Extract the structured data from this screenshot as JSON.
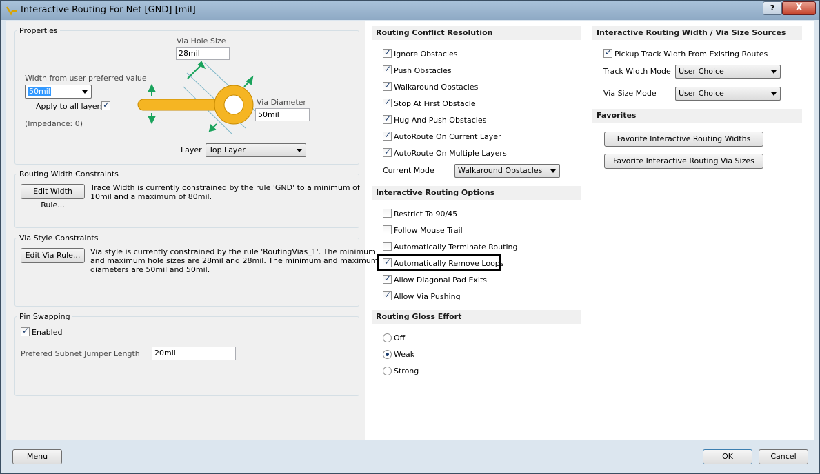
{
  "window": {
    "title": "Interactive Routing For Net [GND] [mil]",
    "help_label": "?",
    "close_label": "X"
  },
  "properties": {
    "title": "Properties",
    "via_hole_size_label": "Via Hole Size",
    "via_hole_size_value": "28mil",
    "width_label": "Width from user preferred value",
    "width_value": "50mil",
    "apply_all_layers": "Apply to all layers",
    "impedance": "(Impedance: 0)",
    "via_diameter_label": "Via Diameter",
    "via_diameter_value": "50mil",
    "layer_label": "Layer",
    "layer_value": "Top Layer"
  },
  "routing_width": {
    "title": "Routing Width Constraints",
    "button": "Edit Width Rule...",
    "text1": "Trace Width is currently constrained by the rule 'GND' to a minimum of",
    "text2": "10mil and a maximum of 80mil."
  },
  "via_style": {
    "title": "Via Style Constraints",
    "button": "Edit Via Rule...",
    "text1": "Via style is currently constrained by the rule 'RoutingVias_1'. The minimum",
    "text2": "and maximum hole sizes are 28mil and 28mil. The minimum and maximum",
    "text3": "diameters are 50mil and 50mil."
  },
  "pin_swapping": {
    "title": "Pin Swapping",
    "enabled_label": "Enabled",
    "jumper_label": "Prefered Subnet Jumper Length",
    "jumper_value": "20mil"
  },
  "conflict": {
    "title": "Routing Conflict Resolution",
    "items": [
      {
        "label": "Ignore Obstacles",
        "checked": true
      },
      {
        "label": "Push Obstacles",
        "checked": true
      },
      {
        "label": "Walkaround Obstacles",
        "checked": true
      },
      {
        "label": "Stop At First Obstacle",
        "checked": true
      },
      {
        "label": "Hug And Push Obstacles",
        "checked": true
      },
      {
        "label": "AutoRoute On Current Layer",
        "checked": true
      },
      {
        "label": "AutoRoute On Multiple Layers",
        "checked": true
      }
    ],
    "mode_label": "Current Mode",
    "mode_value": "Walkaround Obstacles"
  },
  "options": {
    "title": "Interactive Routing Options",
    "items": [
      {
        "label": "Restrict To 90/45",
        "checked": false
      },
      {
        "label": "Follow Mouse Trail",
        "checked": false
      },
      {
        "label": "Automatically Terminate Routing",
        "checked": false
      },
      {
        "label": "Automatically Remove Loops",
        "checked": true
      },
      {
        "label": "Allow Diagonal Pad Exits",
        "checked": true
      },
      {
        "label": "Allow Via Pushing",
        "checked": true
      }
    ]
  },
  "gloss": {
    "title": "Routing Gloss Effort",
    "items": [
      {
        "label": "Off",
        "selected": false
      },
      {
        "label": "Weak",
        "selected": true
      },
      {
        "label": "Strong",
        "selected": false
      }
    ]
  },
  "sources": {
    "title": "Interactive Routing Width / Via Size Sources",
    "pickup_label": "Pickup Track Width From Existing Routes",
    "track_mode_label": "Track Width Mode",
    "track_mode_value": "User Choice",
    "via_mode_label": "Via Size Mode",
    "via_mode_value": "User Choice"
  },
  "favorites": {
    "title": "Favorites",
    "widths_button": "Favorite Interactive Routing Widths",
    "vias_button": "Favorite Interactive Routing Via Sizes"
  },
  "footer": {
    "menu_button": "Menu",
    "ok_button": "OK",
    "cancel_button": "Cancel"
  },
  "colors": {
    "accent": "#3399ff",
    "trace": "#f5b523",
    "arrow": "#1aa35c"
  }
}
